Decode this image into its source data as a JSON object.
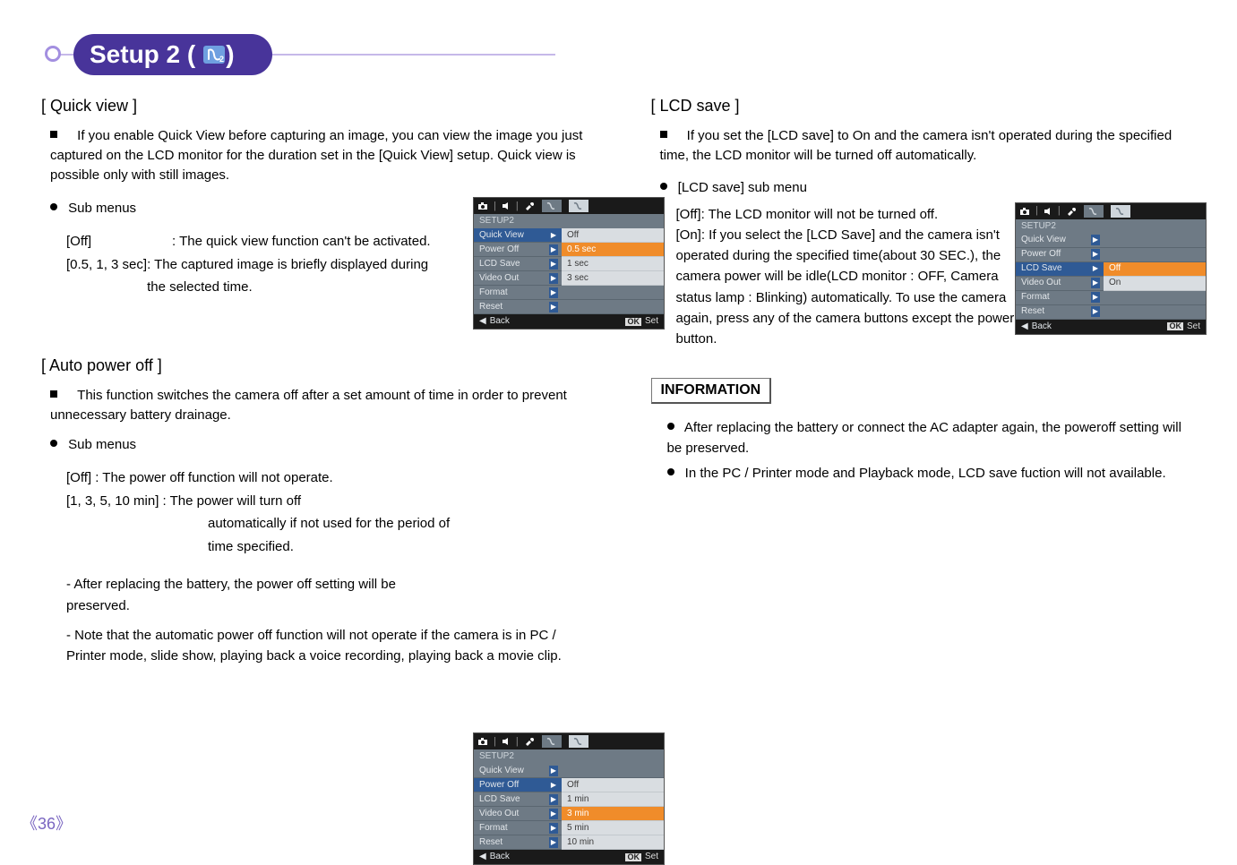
{
  "header": {
    "title_prefix": "Setup 2 (",
    "title_suffix": ")",
    "icon_name": "setup2"
  },
  "page_number": "36",
  "left": {
    "quick_view": {
      "heading": "[ Quick view ]",
      "para": "If you enable Quick View before capturing an image, you can view the image you just captured on the LCD monitor for the duration set in the [Quick View] setup. Quick view is possible only with still images.",
      "sub_label": "Sub menus",
      "def1_key": "[Off]",
      "def1_val": ": The quick view function can't be activated.",
      "def2_key": "[0.5, 1, 3 sec]",
      "def2_val": ": The captured image is briefly displayed during the selected time."
    },
    "auto_power": {
      "heading": "[ Auto power off ]",
      "para": "This function switches the camera off after a set amount of time in order to prevent unnecessary battery drainage.",
      "sub_label": "Sub menus",
      "def1": "[Off]   : The power off function will not operate.",
      "def2_key": "[1, 3, 5, 10 min] : The power will turn off",
      "def2_val": "automatically if not used for the period of time specified.",
      "note1": "- After replacing the battery, the power off setting will be preserved.",
      "note2": "- Note that the automatic power off function will not operate if the camera is in PC / Printer mode, slide show, playing back a voice recording, playing back a movie clip."
    }
  },
  "right": {
    "lcd_save": {
      "heading": "[ LCD save ]",
      "para": "If you set the [LCD save] to On and the camera isn't operated during the specified time, the LCD monitor will be turned off automatically.",
      "sub_label": "[LCD save] sub menu",
      "off_line": "[Off]: The LCD monitor will not be turned off.",
      "on_line": "[On]: If you select the [LCD Save] and the camera isn't operated during the specified time(about 30 SEC.), the camera power will be idle(LCD monitor : OFF, Camera status lamp : Blinking) automatically. To use the camera again, press any of the camera buttons except the power button."
    },
    "info": {
      "head": "INFORMATION",
      "b1": "After replacing the battery or connect the AC adapter again, the poweroff setting will be preserved.",
      "b2": "In the PC / Printer mode and Playback mode, LCD save fuction will not available."
    }
  },
  "menu": {
    "header": "SETUP2",
    "left_items": [
      "Quick View",
      "Power Off",
      "LCD Save",
      "Video Out",
      "Format",
      "Reset"
    ],
    "back": "Back",
    "set": "Set",
    "ok": "OK",
    "shot1_values": [
      "Off",
      "0.5 sec",
      "1 sec",
      "3 sec"
    ],
    "shot2_values": [
      "Off",
      "1 min",
      "3 min",
      "5 min",
      "10 min"
    ],
    "shot3_values": [
      "Off",
      "On"
    ]
  }
}
